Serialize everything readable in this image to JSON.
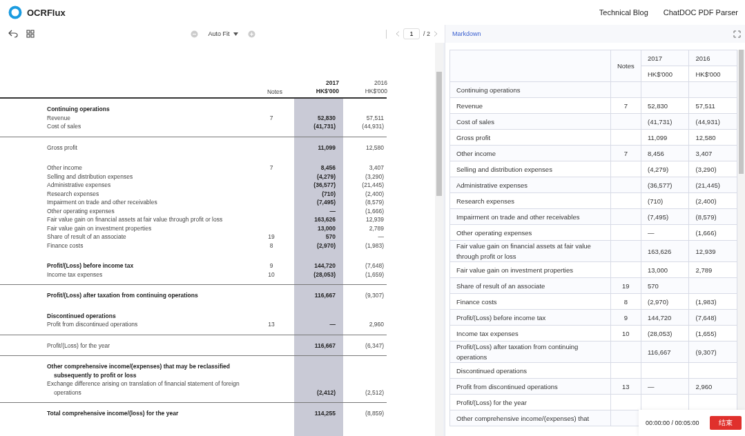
{
  "header": {
    "logo": "OCRFlux",
    "nav": [
      "Technical Blog",
      "ChatDOC PDF Parser"
    ]
  },
  "viewer": {
    "zoom": "Auto Fit",
    "page": "1",
    "page_total": "/ 2"
  },
  "pdf": {
    "columns": {
      "notes": "Notes",
      "year_1": "2017",
      "unit_1": "HK$'000",
      "year_2": "2016",
      "unit_2": "HK$'000"
    },
    "groups": [
      {
        "rule": true,
        "rows": [
          {
            "label": "Continuing operations",
            "bold": true
          },
          {
            "label": "Revenue",
            "notes": "7",
            "v1": "52,830",
            "v2": "57,511",
            "bold": false
          },
          {
            "label": "Cost of sales",
            "v1": "(41,731)",
            "v2": "(44,931)",
            "bold": false
          }
        ]
      },
      {
        "rule": false,
        "rows": [
          {
            "label": "Gross profit",
            "v1": "11,099",
            "v2": "12,580",
            "bold": false
          }
        ]
      },
      {
        "rule": false,
        "rows": [
          {
            "label": "Other income",
            "notes": "7",
            "v1": "8,456",
            "v2": "3,407",
            "bold": false
          },
          {
            "label": "Selling and distribution expenses",
            "v1": "(4,279)",
            "v2": "(3,290)",
            "bold": false
          },
          {
            "label": "Administrative expenses",
            "v1": "(36,577)",
            "v2": "(21,445)",
            "bold": false
          },
          {
            "label": "Research expenses",
            "v1": "(710)",
            "v2": "(2,400)",
            "bold": false
          },
          {
            "label": "Impairment on trade and other receivables",
            "v1": "(7,495)",
            "v2": "(8,579)",
            "bold": false
          },
          {
            "label": "Other operating expenses",
            "v1": "—",
            "v2": "(1,666)",
            "bold": false
          },
          {
            "label": "Fair value gain on financial assets at fair value through profit or loss",
            "v1": "163,626",
            "v2": "12,939",
            "bold": false
          },
          {
            "label": "Fair value gain on investment properties",
            "v1": "13,000",
            "v2": "2,789",
            "bold": false
          },
          {
            "label": "Share of result of an associate",
            "notes": "19",
            "v1": "570",
            "v2": "—",
            "bold": false
          },
          {
            "label": "Finance costs",
            "notes": "8",
            "v1": "(2,970)",
            "v2": "(1,983)",
            "bold": false
          }
        ]
      },
      {
        "rule": true,
        "rows": [
          {
            "label": "Profit/(Loss) before income tax",
            "notes": "9",
            "v1": "144,720",
            "v2": "(7,648)",
            "bold": true
          },
          {
            "label": "Income tax expenses",
            "notes": "10",
            "v1": "(28,053)",
            "v2": "(1,659)",
            "bold": false
          }
        ]
      },
      {
        "rule": false,
        "rows": [
          {
            "label": "Profit/(Loss) after taxation from continuing operations",
            "v1": "116,667",
            "v2": "(9,307)",
            "bold": true
          }
        ]
      },
      {
        "rule": true,
        "rows": [
          {
            "label": "Discontinued operations",
            "bold": true
          },
          {
            "label": "Profit from discontinued operations",
            "notes": "13",
            "v1": "—",
            "v2": "2,960",
            "bold": false
          }
        ]
      },
      {
        "rule": true,
        "rows": [
          {
            "label": "Profit/(Loss) for the year",
            "v1": "116,667",
            "v2": "(6,347)",
            "bold": false
          }
        ]
      },
      {
        "rule": true,
        "rows": [
          {
            "label": "Other comprehensive income/(expenses) that may be reclassified subsequently to profit or loss",
            "bold": true
          },
          {
            "label": "Exchange difference arising on translation of financial statement of foreign operations",
            "v1": "(2,412)",
            "v2": "(2,512)",
            "bold": false
          }
        ]
      },
      {
        "rule": false,
        "rows": [
          {
            "label": "Total comprehensive income/(loss) for the year",
            "v1": "114,255",
            "v2": "(8,859)",
            "bold": true
          }
        ]
      }
    ]
  },
  "result": {
    "tabs": [
      {
        "label": "Markdown",
        "selected": true
      }
    ],
    "columns": {
      "notes": "Notes",
      "year_1": "2017",
      "unit_1": "HK$'000",
      "year_2": "2016",
      "unit_2": "HK$'000"
    },
    "rows": [
      {
        "label": "Continuing operations"
      },
      {
        "label": "Revenue",
        "notes": "7",
        "v1": "52,830",
        "v2": "57,511"
      },
      {
        "label": "Cost of sales",
        "v1": "(41,731)",
        "v2": "(44,931)"
      },
      {
        "label": "Gross profit",
        "v1": "11,099",
        "v2": "12,580"
      },
      {
        "label": "Other income",
        "notes": "7",
        "v1": "8,456",
        "v2": "3,407"
      },
      {
        "label": "Selling and distribution expenses",
        "v1": "(4,279)",
        "v2": "(3,290)"
      },
      {
        "label": "Administrative expenses",
        "v1": "(36,577)",
        "v2": "(21,445)"
      },
      {
        "label": "Research expenses",
        "v1": "(710)",
        "v2": "(2,400)"
      },
      {
        "label": "Impairment on trade and other receivables",
        "v1": "(7,495)",
        "v2": "(8,579)"
      },
      {
        "label": "Other operating expenses",
        "v1": "—",
        "v2": "(1,666)"
      },
      {
        "label": "Fair value gain on financial assets at fair value through profit or loss",
        "v1": "163,626",
        "v2": "12,939"
      },
      {
        "label": "Fair value gain on investment properties",
        "v1": "13,000",
        "v2": "2,789"
      },
      {
        "label": "Share of result of an associate",
        "notes": "19",
        "v1": "570"
      },
      {
        "label": "Finance costs",
        "notes": "8",
        "v1": "(2,970)",
        "v2": "(1,983)"
      },
      {
        "label": "Profit/(Loss) before income tax",
        "notes": "9",
        "v1": "144,720",
        "v2": "(7,648)"
      },
      {
        "label": "Income tax expenses",
        "notes": "10",
        "v1": "(28,053)",
        "v2": "(1,655)"
      },
      {
        "label": "Profit/(Loss) after taxation from continuing operations",
        "v1": "116,667",
        "v2": "(9,307)"
      },
      {
        "label": "Discontinued operations"
      },
      {
        "label": "Profit from discontinued operations",
        "notes": "13",
        "v1": "—",
        "v2": "2,960"
      },
      {
        "label": "Profit/(Loss) for the year"
      },
      {
        "label": "Other comprehensive income/(expenses) that"
      }
    ]
  },
  "timer": {
    "time": "00:00:00 / 00:05:00",
    "button": "结束"
  }
}
